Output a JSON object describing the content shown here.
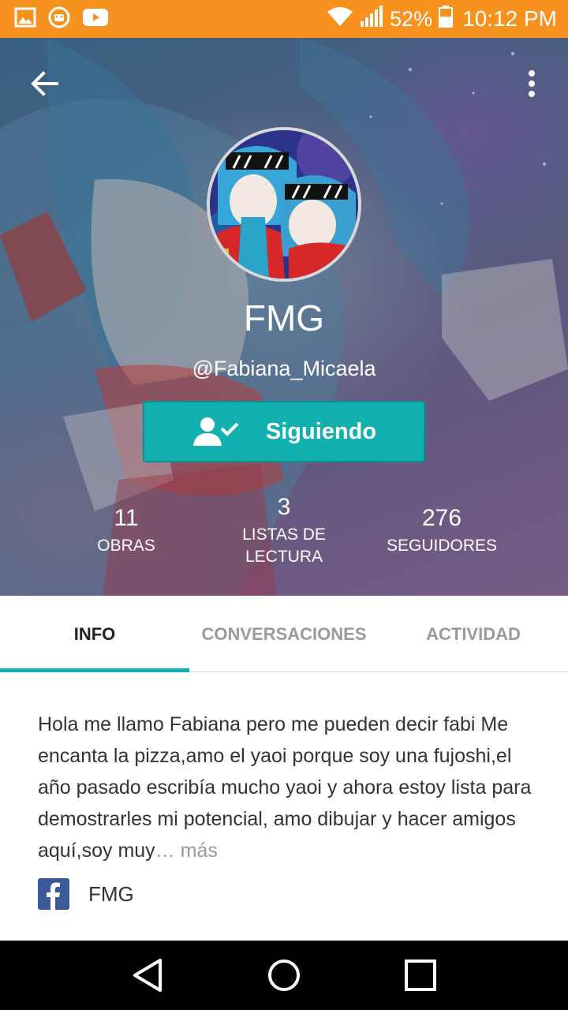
{
  "status_bar": {
    "battery": "52%",
    "time": "10:12 PM",
    "icons": [
      "image-icon",
      "android-icon",
      "youtube-icon",
      "wifi-icon",
      "signal-icon",
      "battery-icon"
    ]
  },
  "profile": {
    "name": "FMG",
    "handle": "@Fabiana_Micaela",
    "follow_label": "Siguiendo",
    "stats": [
      {
        "value": "11",
        "label": "OBRAS"
      },
      {
        "value": "3",
        "label_line1": "LISTAS DE",
        "label_line2": "LECTURA"
      },
      {
        "value": "276",
        "label": "SEGUIDORES"
      }
    ]
  },
  "tabs": [
    {
      "label": "INFO",
      "active": true
    },
    {
      "label": "CONVERSACIONES",
      "active": false
    },
    {
      "label": "ACTIVIDAD",
      "active": false
    }
  ],
  "bio": {
    "text": "Hola me llamo Fabiana pero me pueden decir fabi Me encanta la pizza,amo el yaoi porque soy una fujoshi,el año pasado escribía mucho yaoi y ahora estoy lista para demostrarles mi potencial, amo dibujar y hacer amigos aquí,soy muy",
    "more_label": "… más",
    "facebook_name": "FMG"
  },
  "colors": {
    "status_bar": "#f7921e",
    "accent": "#12b0ae",
    "facebook": "#3b5998"
  }
}
